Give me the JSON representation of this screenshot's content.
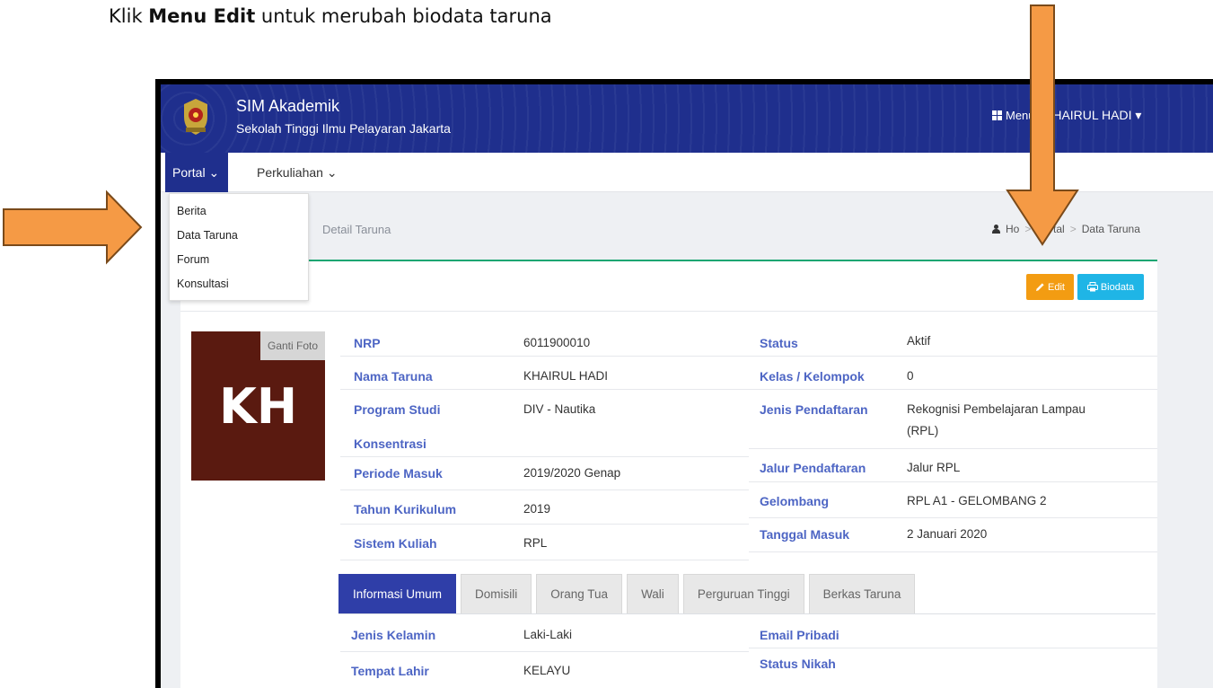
{
  "instruction": {
    "prefix": "Klik ",
    "bold": "Menu Edit",
    "suffix": " untuk merubah biodata taruna"
  },
  "header": {
    "title": "SIM Akademik",
    "subtitle": "Sekolah Tinggi Ilmu Pelayaran Jakarta",
    "menu_label": "Menu",
    "user_label": "KHAIRUL HADI ▾"
  },
  "nav": {
    "portal": "Portal ⌄",
    "perkuliahan": "Perkuliahan ⌄"
  },
  "dropdown": [
    "Berita",
    "Data Taruna",
    "Forum",
    "Konsultasi"
  ],
  "page": {
    "heading": "Detail Taruna"
  },
  "breadcrumb": {
    "home": "Ho",
    "portal": "Portal",
    "current": "Data Taruna",
    "sep": ">"
  },
  "buttons": {
    "edit": "Edit",
    "biodata": "Biodata"
  },
  "photo": {
    "initials": "KH",
    "change_label": "Ganti Foto"
  },
  "left_fields": [
    {
      "label": "NRP",
      "value": "6011900010"
    },
    {
      "label": "Nama Taruna",
      "value": "KHAIRUL HADI"
    },
    {
      "label": "Program Studi",
      "value": "DIV - Nautika"
    },
    {
      "label": "Konsentrasi",
      "value": ""
    },
    {
      "label": "Periode Masuk",
      "value": "2019/2020 Genap"
    },
    {
      "label": "Tahun Kurikulum",
      "value": "2019"
    },
    {
      "label": "Sistem Kuliah",
      "value": "RPL"
    }
  ],
  "right_fields": [
    {
      "label": "Status",
      "value": "Aktif"
    },
    {
      "label": "Kelas / Kelompok",
      "value": "0"
    },
    {
      "label": "Jenis Pendaftaran",
      "value": "Rekognisi Pembelajaran Lampau",
      "value2": "(RPL)"
    },
    {
      "label": "Jalur Pendaftaran",
      "value": "Jalur RPL"
    },
    {
      "label": "Gelombang",
      "value": "RPL A1 - GELOMBANG 2"
    },
    {
      "label": "Tanggal Masuk",
      "value": "2 Januari 2020"
    }
  ],
  "tabs": [
    "Informasi Umum",
    "Domisili",
    "Orang Tua",
    "Wali",
    "Perguruan Tinggi",
    "Berkas Taruna"
  ],
  "info_fields": [
    {
      "label": "Jenis Kelamin",
      "value": "Laki-Laki"
    },
    {
      "label": "Tempat Lahir",
      "value": "KELAYU"
    }
  ],
  "info_right": [
    {
      "label": "Email Pribadi"
    },
    {
      "label": "Status Nikah"
    }
  ],
  "colors": {
    "header": "#1f2f8d",
    "accent_green": "#1aa672",
    "edit": "#f39c12",
    "biodata": "#1fb5e6",
    "label": "#4d65c4",
    "arrow": "#f59a45"
  }
}
